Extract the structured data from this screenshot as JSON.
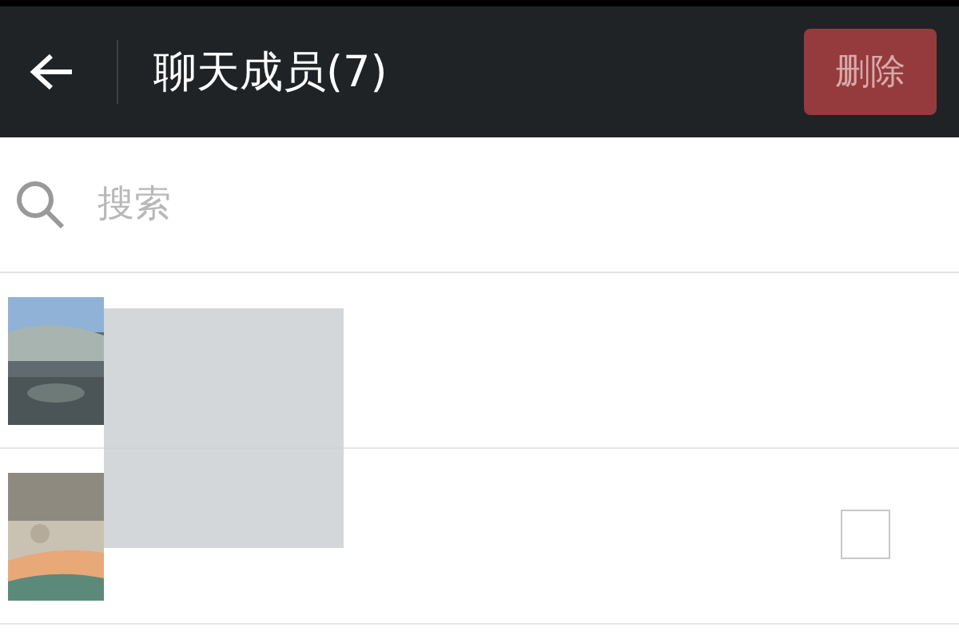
{
  "header": {
    "title": "聊天成员(7)",
    "delete_button": {
      "label": "删除",
      "disabled": true
    }
  },
  "search": {
    "placeholder": "搜索"
  },
  "members": [
    {
      "kind": "self"
    },
    {
      "kind": "selectable",
      "checked": false
    }
  ]
}
